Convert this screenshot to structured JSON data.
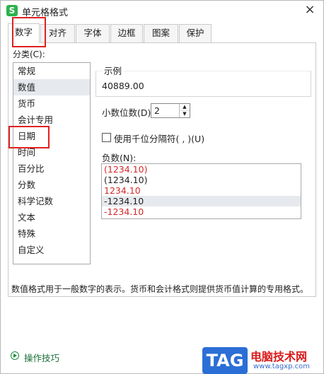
{
  "dialog": {
    "title": "单元格格式",
    "app_icon_letter": "S",
    "close_glyph": "×"
  },
  "tabs": [
    {
      "label": "数字"
    },
    {
      "label": "对齐"
    },
    {
      "label": "字体"
    },
    {
      "label": "边框"
    },
    {
      "label": "图案"
    },
    {
      "label": "保护"
    }
  ],
  "active_tab": "数字",
  "category": {
    "label": "分类(C):",
    "items": [
      "常规",
      "数值",
      "货币",
      "会计专用",
      "日期",
      "时间",
      "百分比",
      "分数",
      "科学记数",
      "文本",
      "特殊",
      "自定义"
    ],
    "selected": "数值"
  },
  "sample": {
    "label": "示例",
    "value": "40889.00"
  },
  "decimal": {
    "label": "小数位数(D):",
    "value": "2",
    "up_glyph": "▲",
    "down_glyph": "▼"
  },
  "thousands": {
    "label": "使用千位分隔符( , )(U)",
    "checked": false
  },
  "negative": {
    "label": "负数(N):",
    "items": [
      {
        "text": "(1234.10)",
        "color": "#d42a2a"
      },
      {
        "text": "(1234.10)",
        "color": "#222222"
      },
      {
        "text": "1234.10",
        "color": "#d42a2a"
      },
      {
        "text": "-1234.10",
        "color": "#222222"
      },
      {
        "text": "-1234.10",
        "color": "#d42a2a"
      }
    ],
    "selected_index": 3
  },
  "description": "数值格式用于一般数字的表示。货币和会计格式则提供货币值计算的专用格式。",
  "tips": {
    "label": "操作技巧"
  },
  "watermark": {
    "logo": "TAG",
    "name": "电脑技术网",
    "url": "www.tagxp.com"
  },
  "colors": {
    "highlight": "#e02020",
    "link": "#1a6f3a",
    "selection": "#e6e9ee"
  }
}
